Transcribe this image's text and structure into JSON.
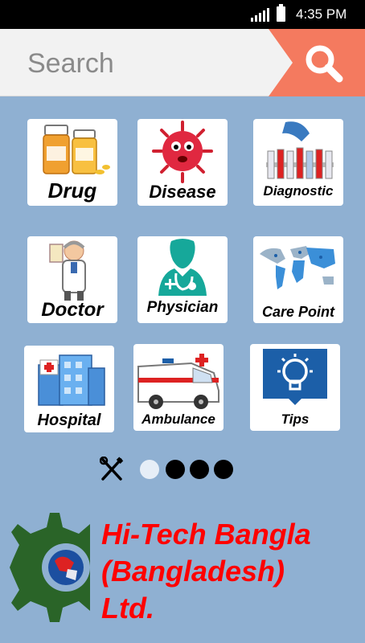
{
  "status_bar": {
    "time": "4:35 PM"
  },
  "search": {
    "placeholder": "Search"
  },
  "tiles": [
    {
      "label": "Drug"
    },
    {
      "label": "Disease"
    },
    {
      "label": "Diagnostic"
    },
    {
      "label": "Doctor"
    },
    {
      "label": "Physician"
    },
    {
      "label": "Care Point"
    },
    {
      "label": "Hospital"
    },
    {
      "label": "Ambulance"
    },
    {
      "label": "Tips"
    }
  ],
  "pager": {
    "total": 4,
    "current": 1
  },
  "company": {
    "line1": "Hi-Tech Bangla",
    "line2": "(Bangladesh)",
    "line3": "Ltd."
  },
  "colors": {
    "background": "#8fb0d2",
    "search_button": "#f47a5f",
    "brand_red": "#ff0000",
    "logo_green": "#2a6428"
  }
}
